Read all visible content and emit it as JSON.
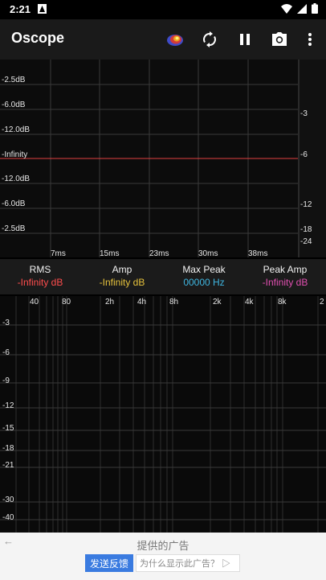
{
  "status_bar": {
    "time": "2:21"
  },
  "app_bar": {
    "title": "Oscope",
    "icons": [
      "heatmap-icon",
      "sync-icon",
      "pause-icon",
      "camera-icon",
      "more-vert-icon"
    ]
  },
  "oscilloscope": {
    "left_labels": [
      "-2.5dB",
      "-6.0dB",
      "-12.0dB",
      "-Infinity",
      "-12.0dB",
      "-6.0dB",
      "-2.5dB"
    ],
    "right_labels": [
      "-3",
      "-6",
      "-12",
      "-18",
      "-24"
    ],
    "time_labels": [
      "7ms",
      "15ms",
      "23ms",
      "30ms",
      "38ms"
    ],
    "trace_color": "#e04040"
  },
  "stats": {
    "rms": {
      "label": "RMS",
      "value": "-Infinity dB",
      "color": "#ff4d4d"
    },
    "amp": {
      "label": "Amp",
      "value": "-Infinity dB",
      "color": "#e6c23c"
    },
    "max_peak": {
      "label": "Max Peak",
      "value": "00000 Hz",
      "color": "#3fb6e0"
    },
    "peak_amp": {
      "label": "Peak Amp",
      "value": "-Infinity dB",
      "color": "#e04fb0"
    }
  },
  "spectrum": {
    "freq_labels": [
      "40",
      "80",
      "2h",
      "4h",
      "8h",
      "2k",
      "4k",
      "8k",
      "2"
    ],
    "db_labels": [
      "-3",
      "-6",
      "-9",
      "-12",
      "-15",
      "-18",
      "-21",
      "-30",
      "-40"
    ]
  },
  "ad": {
    "back": "←",
    "title": "提供的广告",
    "feedback_button": "发送反馈",
    "why_button": "为什么显示此广告？ ▷"
  },
  "colors": {
    "background": "#000000",
    "app_bar": "#1a1a1a",
    "feedback": "#3a7be0"
  }
}
